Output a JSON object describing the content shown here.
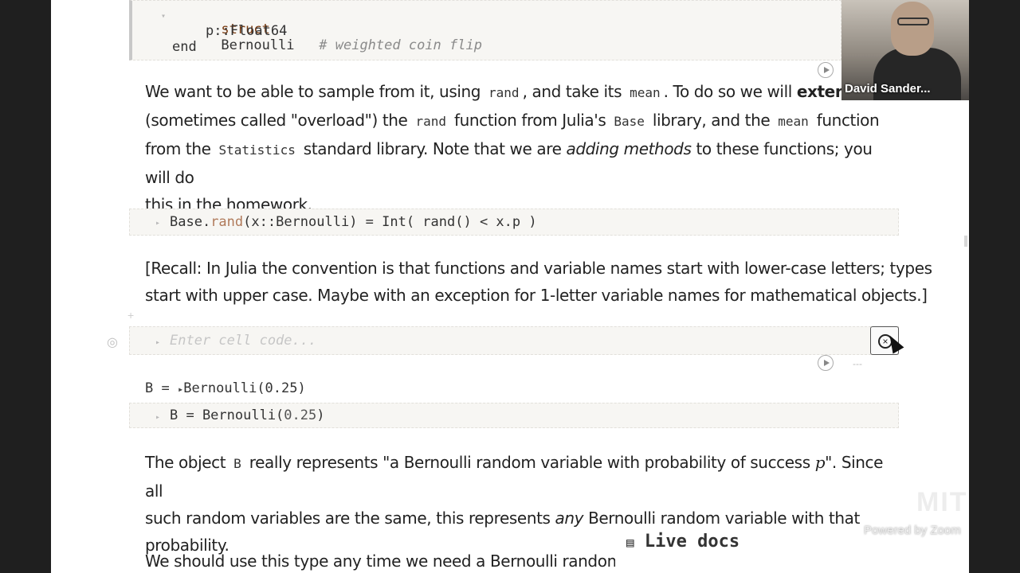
{
  "struct_cell": {
    "line1_kw": "struct",
    "line1_name": "Bernoulli",
    "line1_comment": "# weighted coin flip",
    "line2": "p::Float64",
    "line3": "end"
  },
  "para1": {
    "t1": "We want to be able to sample from it, using",
    "c1": "rand",
    "t2": ", and take its",
    "c2": "mean",
    "t3": ". To do so we will",
    "b1": "extend",
    "t4": "(sometimes called \"overload\") the",
    "c3": "rand",
    "t5": "function from Julia's",
    "c4": "Base",
    "t6": "library, and the",
    "c5": "mean",
    "t7": "function",
    "t8": "from the",
    "c6": "Statistics",
    "t9": "standard library. Note that we are",
    "i1": "adding methods",
    "t10": "to these functions; you will do",
    "t11": "this in the homework."
  },
  "rand_cell": {
    "p1": "Base.",
    "p2": "rand",
    "p3": "(x::Bernoulli) = Int( rand() < x.p )"
  },
  "para2": {
    "line1": "[Recall: In Julia the convention is that functions and variable names start with lower-case letters; types",
    "line2": "start with upper case. Maybe with an exception for 1-letter variable names for mathematical objects.]"
  },
  "empty_cell": {
    "placeholder": "Enter cell code..."
  },
  "b_cell": {
    "output_lhs": "B =",
    "output_rhs": "Bernoulli(0.25)",
    "code_lhs": "B = Bernoulli(",
    "code_num": "0.25",
    "code_end": ")"
  },
  "para3": {
    "t1": "The object",
    "c1": "B",
    "t2": "really represents \"a Bernoulli random variable with probability of success",
    "i1": "p",
    "t3": "\". Since all",
    "t4": "such random variables are the same, this represents",
    "i2": "any",
    "t5": "Bernoulli random variable with that",
    "t6": "probability."
  },
  "para4": {
    "t1": "We should use this type any time we need a Bernoulli random va"
  },
  "live_docs": {
    "icon": "books-icon",
    "label": "Live docs"
  },
  "video": {
    "name": "David Sander..."
  },
  "watermark": {
    "logo": "MIT",
    "powered": "Powered by Zoom"
  }
}
